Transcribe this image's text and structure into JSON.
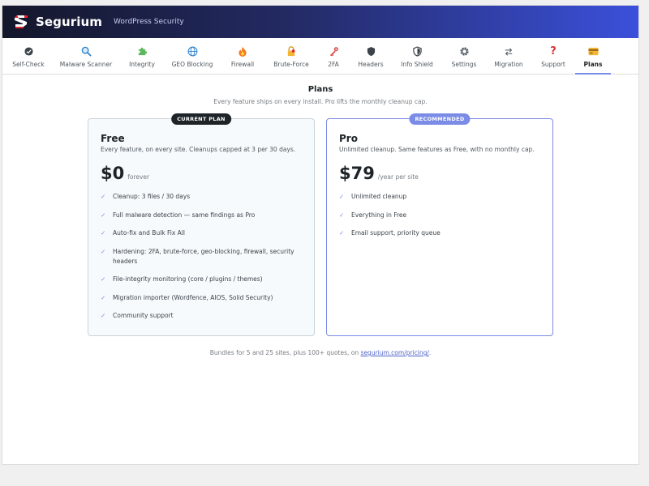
{
  "header": {
    "brand": "Segurium",
    "subtitle": "WordPress Security",
    "logo_icon": "segurium-s-logo",
    "accent": "#3b50db"
  },
  "nav": {
    "items": [
      {
        "label": "Self-Check",
        "icon": "check-circle-icon"
      },
      {
        "label": "Malware Scanner",
        "icon": "magnifier-icon"
      },
      {
        "label": "Integrity",
        "icon": "puzzle-icon"
      },
      {
        "label": "GEO Blocking",
        "icon": "globe-icon"
      },
      {
        "label": "Firewall",
        "icon": "flame-icon"
      },
      {
        "label": "Brute-Force",
        "icon": "padlock-icon"
      },
      {
        "label": "2FA",
        "icon": "key-icon"
      },
      {
        "label": "Headers",
        "icon": "shield-icon"
      },
      {
        "label": "Info Shield",
        "icon": "shield-check-icon"
      },
      {
        "label": "Settings",
        "icon": "gear-icon"
      },
      {
        "label": "Migration",
        "icon": "swap-arrows-icon"
      },
      {
        "label": "Support",
        "icon": "question-icon"
      },
      {
        "label": "Plans",
        "icon": "credit-card-icon"
      }
    ],
    "active": "Plans"
  },
  "page": {
    "title": "Plans",
    "subtitle": "Every feature ships on every install. Pro lifts the monthly cleanup cap."
  },
  "plans": {
    "free": {
      "badge": "CURRENT PLAN",
      "name": "Free",
      "description": "Every feature, on every site. Cleanups capped at 3 per 30 days.",
      "price": "$0",
      "period": "forever",
      "features": [
        "Cleanup: 3 files / 30 days",
        "Full malware detection — same findings as Pro",
        "Auto-fix and Bulk Fix All",
        "Hardening: 2FA, brute-force, geo-blocking, firewall, security headers",
        "File-integrity monitoring (core / plugins / themes)",
        "Migration importer (Wordfence, AIOS, Solid Security)",
        "Community support"
      ]
    },
    "pro": {
      "badge": "RECOMMENDED",
      "name": "Pro",
      "description": "Unlimited cleanup. Same features as Free, with no monthly cap.",
      "price": "$79",
      "period": "/year per site",
      "features": [
        "Unlimited cleanup",
        "Everything in Free",
        "Email support, priority queue"
      ]
    }
  },
  "footer": {
    "text_before": "Bundles for 5 and 25 sites, plus 100+ quotes, on ",
    "link_text": "segurium.com/pricing/",
    "text_after": "."
  },
  "check_mark": "✓"
}
